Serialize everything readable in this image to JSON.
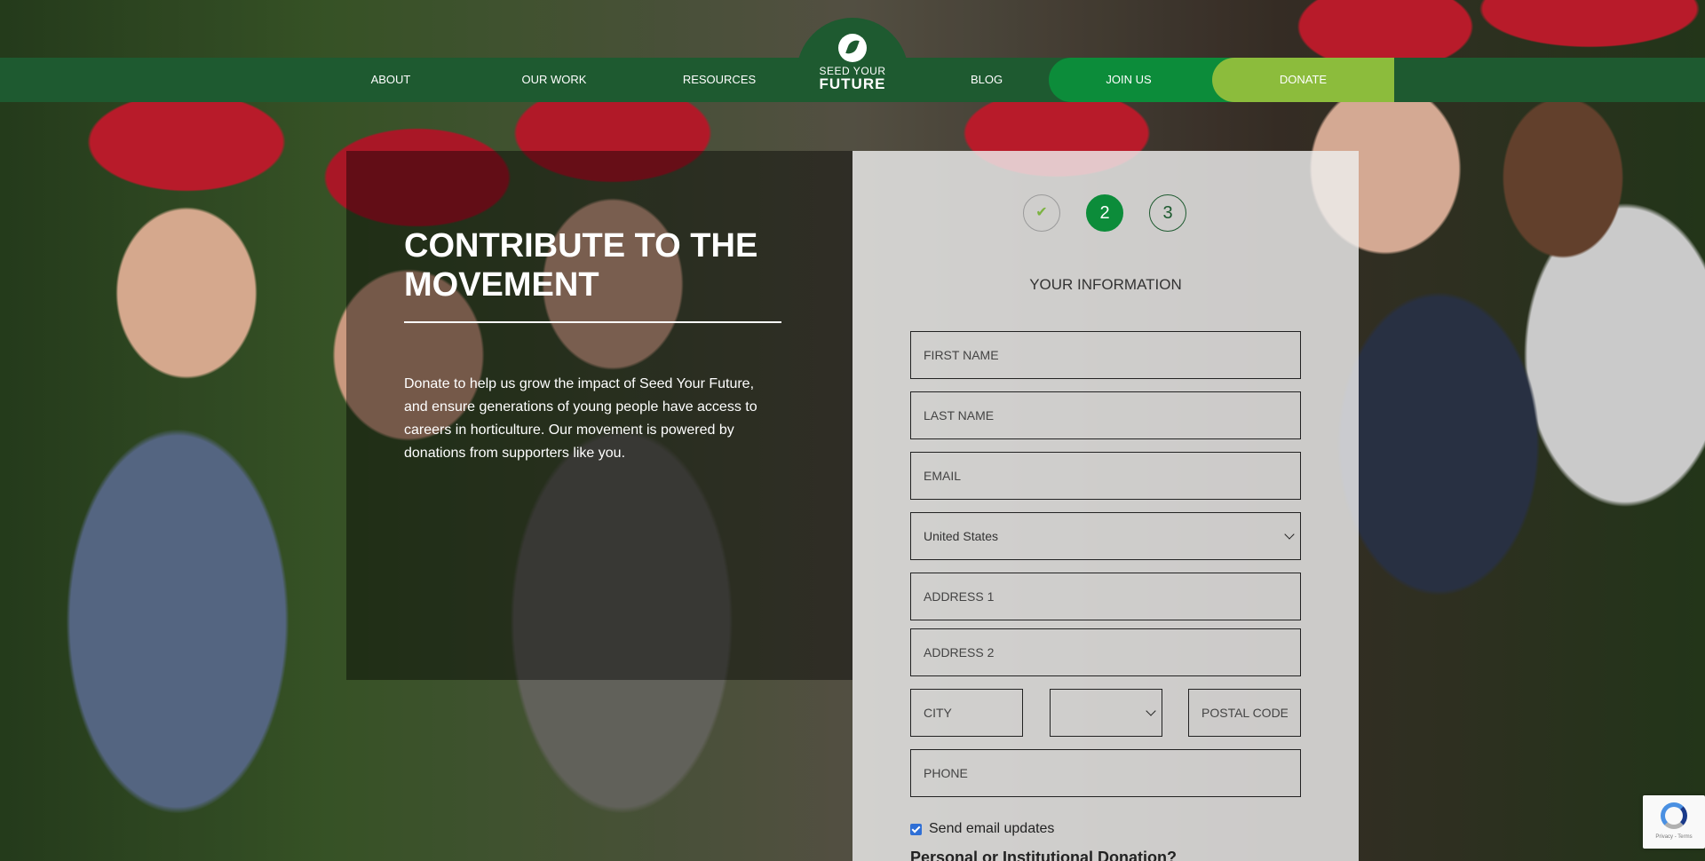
{
  "nav": {
    "about": "ABOUT",
    "our_work": "OUR WORK",
    "resources": "RESOURCES",
    "blog": "BLOG",
    "join_us": "JOIN US",
    "donate": "DONATE"
  },
  "logo": {
    "line1": "SEED YOUR",
    "line2": "FUTURE"
  },
  "hero": {
    "title": "CONTRIBUTE TO THE MOVEMENT",
    "body": "Donate to help us grow the impact of Seed Your Future, and ensure generations of young people have access to careers in horticulture. Our movement is powered by donations from supporters like you."
  },
  "steps": {
    "step1": "✔",
    "step2": "2",
    "step3": "3"
  },
  "form": {
    "heading": "YOUR INFORMATION",
    "first_name_placeholder": "FIRST NAME",
    "last_name_placeholder": "LAST NAME",
    "email_placeholder": "EMAIL",
    "country_value": "United States",
    "address1_placeholder": "ADDRESS 1",
    "address2_placeholder": "ADDRESS 2",
    "city_placeholder": "CITY",
    "state_value": "",
    "postal_code_placeholder": "POSTAL CODE",
    "phone_placeholder": "PHONE",
    "email_updates_label": "Send email updates",
    "email_updates_checked": true,
    "next_heading": "Personal or Institutional Donation?"
  },
  "recaptcha": {
    "footer": "Privacy - Terms"
  },
  "colors": {
    "nav_green": "#1e5a30",
    "join_green": "#0c8c3a",
    "donate_lime": "#8cbc3c"
  }
}
